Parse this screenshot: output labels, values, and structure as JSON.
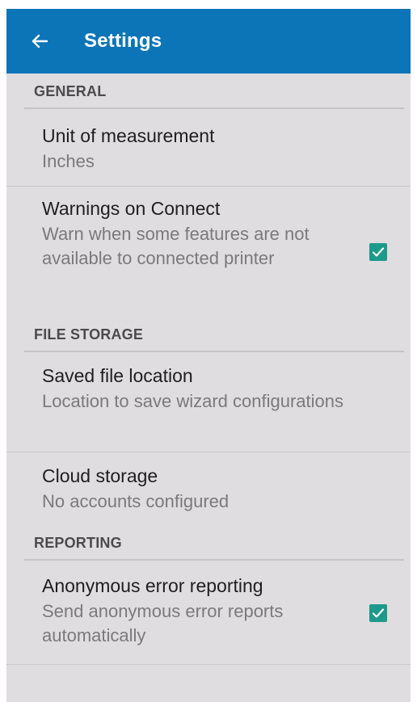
{
  "app_bar": {
    "title": "Settings",
    "back_icon": "arrow-back-icon",
    "color": "#0b75b8"
  },
  "sections": {
    "general": {
      "header": "GENERAL",
      "unit": {
        "title": "Unit of measurement",
        "summary": "Inches"
      },
      "warnings": {
        "title": "Warnings on Connect",
        "summary": "Warn when some features are not available to connected printer",
        "checked": true
      }
    },
    "file_storage": {
      "header": "FILE STORAGE",
      "saved_location": {
        "title": "Saved file location",
        "summary": "Location to save wizard configurations"
      },
      "cloud": {
        "title": "Cloud storage",
        "summary": "No accounts configured"
      }
    },
    "reporting": {
      "header": "REPORTING",
      "anonymous": {
        "title": "Anonymous error reporting",
        "summary": "Send anonymous error reports automatically",
        "checked": true
      }
    }
  },
  "colors": {
    "background": "#dfdde0",
    "checkbox": "#1c9a8c"
  }
}
